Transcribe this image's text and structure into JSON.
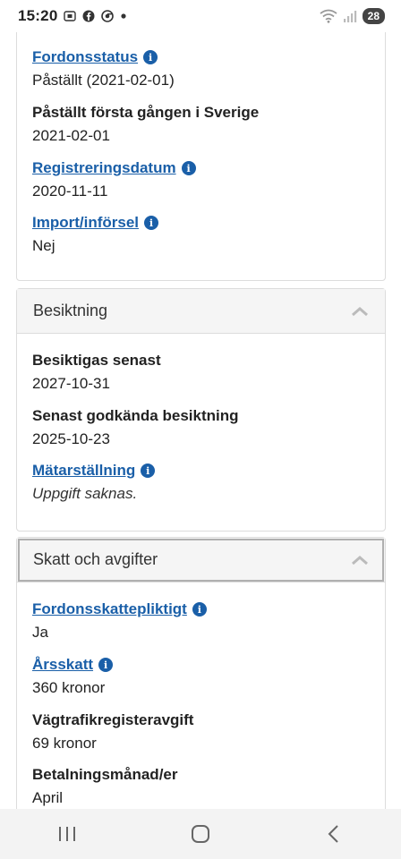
{
  "status_bar": {
    "time": "15:20",
    "battery": "28",
    "left_icons": [
      "screenshot-icon",
      "facebook-icon",
      "chrome-icon",
      "notification-dot-icon"
    ],
    "right_icons": [
      "wifi-icon",
      "signal-icon"
    ]
  },
  "vehicle_status_section": {
    "fields": [
      {
        "label": "Fordonsstatus",
        "value": "Påställt (2021-02-01)",
        "link": true,
        "info": true
      },
      {
        "label": "Påställt första gången i Sverige",
        "value": "2021-02-01",
        "link": false,
        "info": false
      },
      {
        "label": "Registreringsdatum",
        "value": "2020-11-11",
        "link": true,
        "info": true
      },
      {
        "label": "Import/införsel",
        "value": "Nej",
        "link": true,
        "info": true
      }
    ]
  },
  "inspection_section": {
    "title": "Besiktning",
    "fields": [
      {
        "label": "Besiktigas senast",
        "value": "2027-10-31",
        "link": false,
        "info": false
      },
      {
        "label": "Senast godkända besiktning",
        "value": "2025-10-23",
        "link": false,
        "info": false
      },
      {
        "label": "Mätarställning",
        "value": "Uppgift saknas.",
        "link": true,
        "info": true,
        "italic": true
      }
    ]
  },
  "tax_section": {
    "title": "Skatt och avgifter",
    "fields": [
      {
        "label": "Fordonsskattepliktigt",
        "value": "Ja",
        "link": true,
        "info": true
      },
      {
        "label": "Årsskatt",
        "value": "360 kronor",
        "link": true,
        "info": true
      },
      {
        "label": "Vägtrafikregisteravgift",
        "value": "69 kronor",
        "link": false,
        "info": false
      },
      {
        "label": "Betalningsmånad/er",
        "value": "April",
        "link": false,
        "info": false
      }
    ]
  },
  "info_glyph": "i",
  "colors": {
    "link": "#1a5fa8",
    "header_bg": "#f5f5f5",
    "border": "#dcdcdc"
  }
}
